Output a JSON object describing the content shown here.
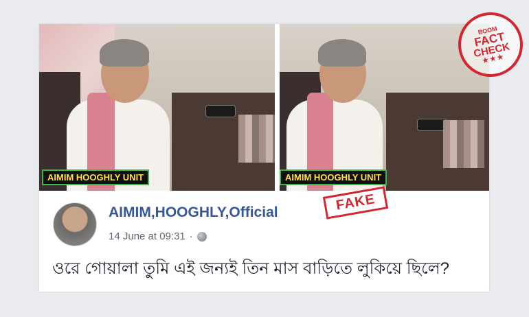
{
  "post": {
    "page_name": "AIMIM,HOOGHLY,Official",
    "date": "14 June at 09:31",
    "separator": "·",
    "text": "ওরে গোয়ালা তুমি এই জন্যই তিন মাস বাড়িতে লুকিয়ে ছিলে?"
  },
  "photos": {
    "watermark_left": "AIMIM HOOGHLY UNIT",
    "watermark_right": "AIMIM HOOGHLY UNIT"
  },
  "stamps": {
    "fact_boom": "BOOM",
    "fact_line1": "FACT",
    "fact_line2": "CHECK",
    "fact_stars": "★★★",
    "fake": "FAKE"
  },
  "icons": {
    "privacy": "globe-icon"
  },
  "colors": {
    "page_name": "#365899",
    "stamp_red": "#d22630",
    "background": "#e9ebee"
  }
}
